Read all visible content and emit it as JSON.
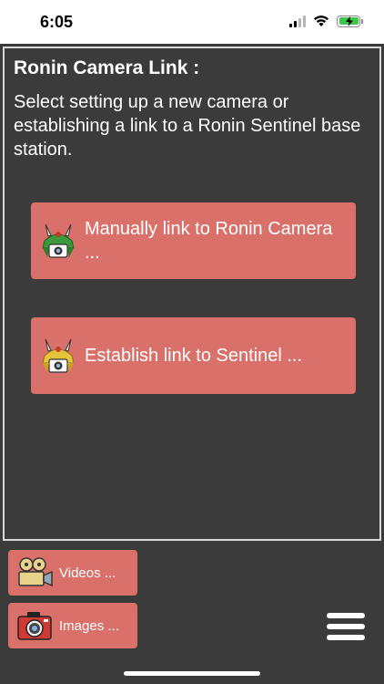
{
  "status_bar": {
    "time": "6:05"
  },
  "main": {
    "title": "Ronin Camera Link :",
    "description": "Select setting up a new camera or establishing a link to a Ronin Sentinel base station.",
    "buttons": [
      {
        "label": "Manually link to Ronin Camera ...",
        "icon": "samurai-camera-icon"
      },
      {
        "label": "Establish link to Sentinel ...",
        "icon": "samurai-sentinel-icon"
      }
    ]
  },
  "bottom": {
    "videos_label": "Videos ...",
    "images_label": "Images ..."
  },
  "colors": {
    "background": "#3b3b3b",
    "button": "#d9706a",
    "text": "#ffffff",
    "battery": "#3ec84a"
  }
}
